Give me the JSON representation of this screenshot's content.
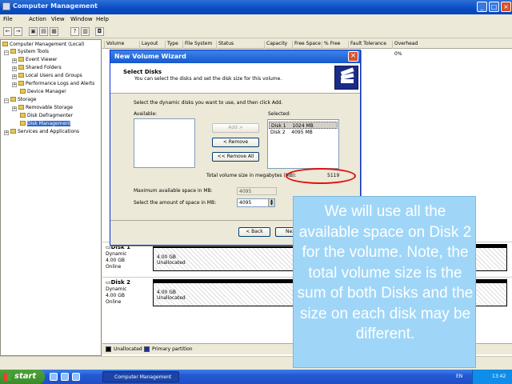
{
  "window": {
    "title": "Computer Management"
  },
  "menu": [
    "File",
    "Action",
    "View",
    "Window",
    "Help"
  ],
  "tree": {
    "items": [
      "Computer Management (Local)",
      "System Tools",
      "Event Viewer",
      "Shared Folders",
      "Local Users and Groups",
      "Performance Logs and Alerts",
      "Device Manager",
      "Storage",
      "Removable Storage",
      "Disk Defragmenter",
      "Disk Management",
      "Services and Applications"
    ]
  },
  "columns": [
    "Volume",
    "Layout",
    "Type",
    "File System",
    "Status",
    "Capacity",
    "Free Space",
    "% Free",
    "Fault Tolerance",
    "Overhead"
  ],
  "overhead_value": "0%",
  "disks": [
    {
      "name": "Disk 1",
      "type": "Dynamic",
      "size": "4.00 GB",
      "status": "Online",
      "part_size": "4.00 GB",
      "part_status": "Unallocated"
    },
    {
      "name": "Disk 2",
      "type": "Dynamic",
      "size": "4.00 GB",
      "status": "Online",
      "part_size": "4.00 GB",
      "part_status": "Unallocated"
    }
  ],
  "legend": {
    "unallocated": "Unallocated",
    "primary": "Primary partition"
  },
  "dialog": {
    "title": "New Volume Wizard",
    "heading": "Select Disks",
    "subheading": "You can select the disks and set the disk size for this volume.",
    "instruction": "Select the dynamic disks you want to use, and then click Add.",
    "available_label": "Available:",
    "selected_label": "Selected:",
    "add": "Add >",
    "remove": "< Remove",
    "remove_all": "<< Remove All",
    "selected_disks": [
      {
        "disk": "Disk 1",
        "size": "1024 MB"
      },
      {
        "disk": "Disk 2",
        "size": "4095 MB"
      }
    ],
    "total_label": "Total volume size in megabytes (MB):",
    "total_value": "5119",
    "max_label": "Maximum available space in MB:",
    "max_value": "4095",
    "amount_label": "Select the amount of space in MB:",
    "amount_value": "4095",
    "back": "< Back",
    "next": "Next"
  },
  "callout": "We will use all the available space on Disk 2 for the volume. Note, the total volume size is the sum of both Disks and the size on each disk may be different.",
  "taskbar": {
    "start": "start",
    "task": "Computer Management",
    "lang": "EN",
    "clock": "13:42"
  },
  "colors": {
    "callout": "#9fd6f8",
    "highlight": "#e01010",
    "titlebar": "#0a4cc4"
  }
}
